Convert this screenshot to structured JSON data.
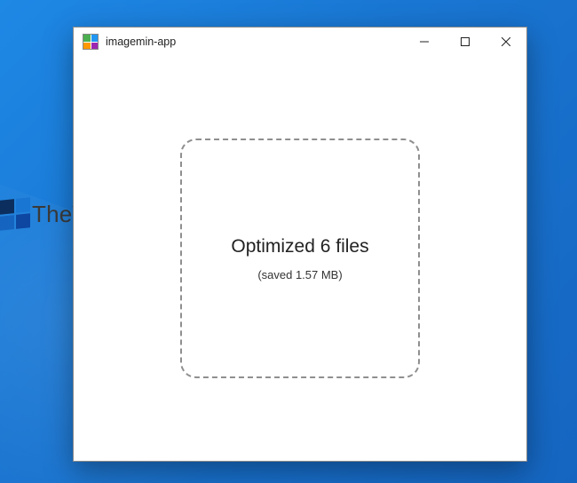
{
  "watermark": {
    "text": "TheWindowsClub"
  },
  "window": {
    "title": "imagemin-app"
  },
  "dropzone": {
    "status_line": "Optimized 6 files",
    "savings_line": "(saved 1.57 MB)"
  }
}
